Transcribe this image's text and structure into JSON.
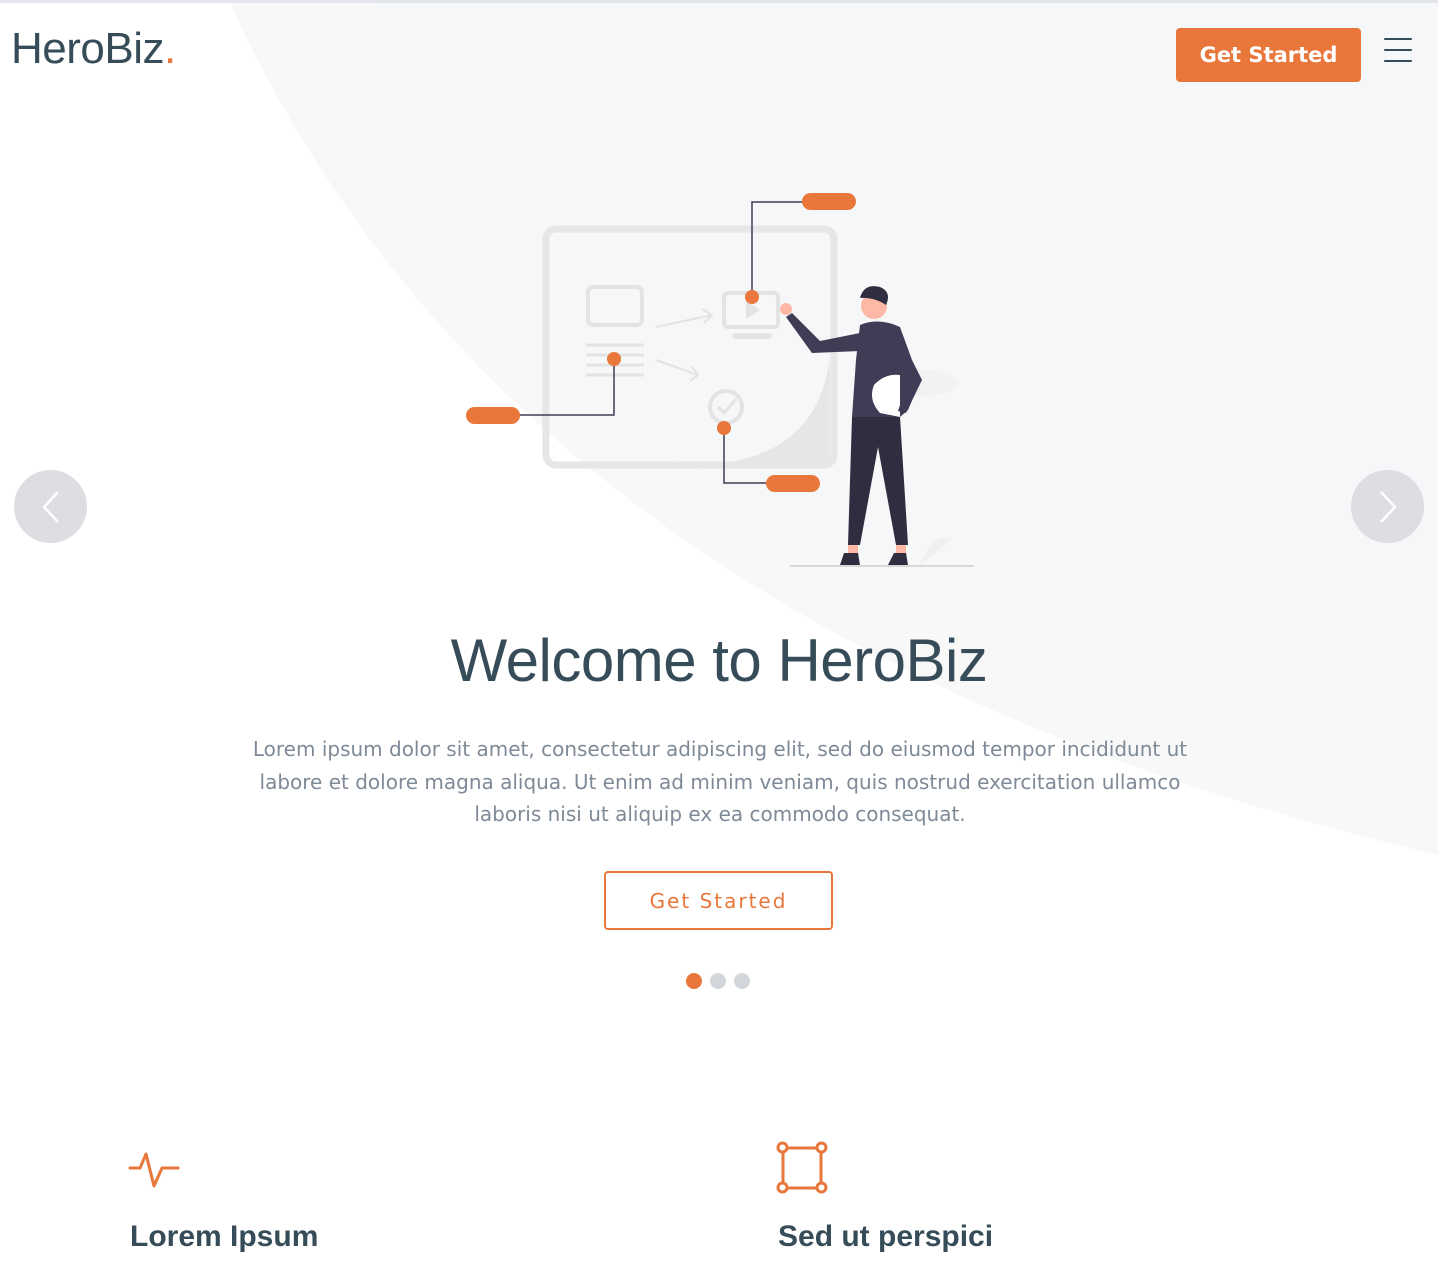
{
  "header": {
    "logo_text": "HeroBiz",
    "logo_dot": ".",
    "cta_label": "Get Started",
    "menu_icon": "hamburger-menu-icon"
  },
  "hero": {
    "title": "Welcome to HeroBiz",
    "description": "Lorem ipsum dolor sit amet, consectetur adipiscing elit, sed do eiusmod tempor incididunt ut labore et dolore magna aliqua. Ut enim ad minim veniam, quis nostrud exercitation ullamco laboris nisi ut aliquip ex ea commodo consequat.",
    "cta_label": "Get Started",
    "prev_icon": "chevron-left-icon",
    "next_icon": "chevron-right-icon",
    "slides_total": 3,
    "active_slide": 1
  },
  "features": [
    {
      "icon": "activity-pulse-icon",
      "title": "Lorem Ipsum"
    },
    {
      "icon": "bounding-box-icon",
      "title": "Sed ut perspici"
    }
  ],
  "colors": {
    "accent": "#e9773c",
    "heading": "#364d59",
    "body_text": "#7e8a98",
    "indicator_inactive": "#d3d6da",
    "arrow_bg": "#dcdee2"
  }
}
